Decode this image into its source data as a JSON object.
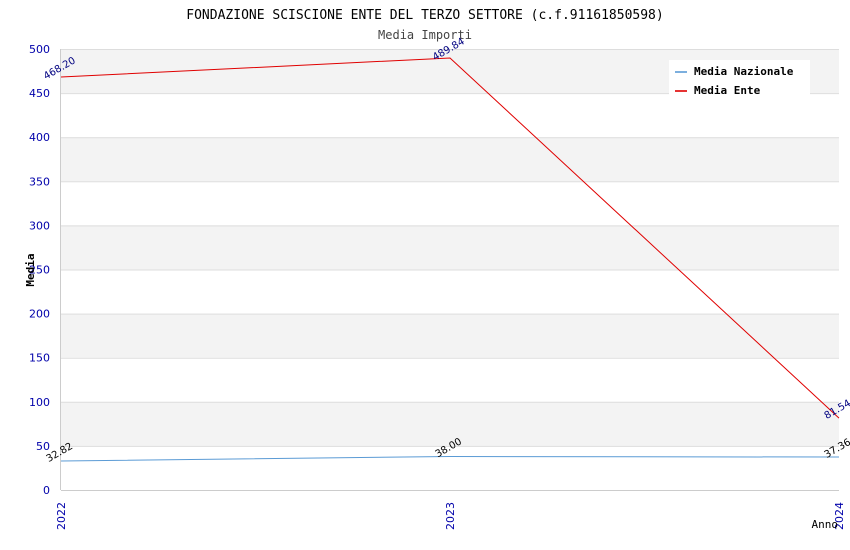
{
  "chart_data": {
    "type": "line",
    "title": "FONDAZIONE SCISCIONE ENTE DEL TERZO SETTORE (c.f.91161850598)",
    "subtitle": "Media Importi",
    "xlabel": "Anno",
    "ylabel": "Media",
    "categories": [
      "2022",
      "2023",
      "2024"
    ],
    "ylim": [
      0,
      500
    ],
    "yticks": [
      0,
      50,
      100,
      150,
      200,
      250,
      300,
      350,
      400,
      450,
      500
    ],
    "grid": true,
    "legend_position": "top-right",
    "series": [
      {
        "name": "Media Nazionale",
        "color": "#5b9bd5",
        "label_color": "#000000",
        "values": [
          32.82,
          38.0,
          37.36
        ],
        "labels": [
          "32.82",
          "38.00",
          "37.36"
        ]
      },
      {
        "name": "Media Ente",
        "color": "#e00000",
        "label_color": "#000080",
        "values": [
          468.2,
          489.84,
          81.54
        ],
        "labels": [
          "468.20",
          "489.84",
          "81.54"
        ]
      }
    ],
    "colors": {
      "axis_tick_text": "#0000aa",
      "band_fill": "#f3f3f3",
      "grid_line": "#dddddd"
    }
  }
}
